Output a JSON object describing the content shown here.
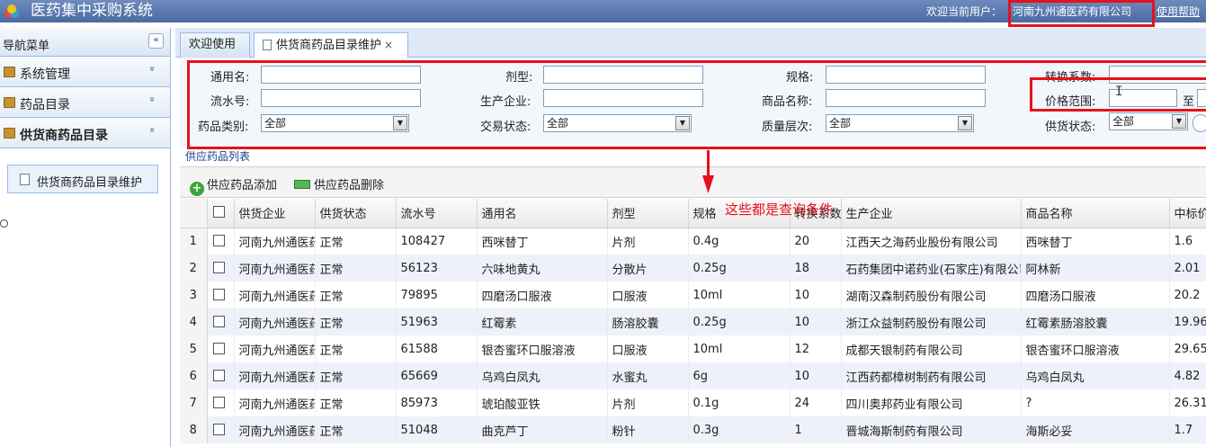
{
  "header": {
    "title": "医药集中采购系统",
    "welcome": "欢迎当前用户：",
    "user": "河南九州通医药有限公司",
    "help": "使用帮助"
  },
  "sidebar": {
    "title": "导航菜单",
    "collapse": "«",
    "groups": [
      {
        "label": "系统管理",
        "chevron": "»"
      },
      {
        "label": "药品目录",
        "chevron": "»"
      },
      {
        "label": "供货商药品目录",
        "chevron": "«"
      }
    ],
    "sub_item": "供货商药品目录维护"
  },
  "tabs": [
    {
      "label": "欢迎使用"
    },
    {
      "label": "供货商药品目录维护",
      "close": "×"
    }
  ],
  "search": {
    "generic_name": "通用名:",
    "dosage_form": "剂型:",
    "spec": "规格:",
    "conversion": "转换系数:",
    "serial_no": "流水号:",
    "manufacturer": "生产企业:",
    "product_name": "商品名称:",
    "price_range": "价格范围:",
    "price_to": "至",
    "category": "药品类别:",
    "trade_status": "交易状态:",
    "quality_level": "质量层次:",
    "supply_status": "供货状态:",
    "category_value": "全部",
    "trade_status_value": "全部",
    "quality_level_value": "全部",
    "supply_status_value": "全部",
    "dropdown_arrow": "▼"
  },
  "list": {
    "title": "供应药品列表",
    "add_button": "供应药品添加",
    "delete_button": "供应药品删除",
    "annotation": "这些都是查询条件"
  },
  "grid": {
    "columns": [
      "供货企业",
      "供货状态",
      "流水号",
      "通用名",
      "剂型",
      "规格",
      "转换系数",
      "生产企业",
      "商品名称",
      "中标价"
    ],
    "rows": [
      {
        "n": "1",
        "supplier": "河南九州通医药有限公司",
        "status": "正常",
        "serial": "108427",
        "name": "西咪替丁",
        "form": "片剂",
        "spec": "0.4g",
        "factor": "20",
        "maker": "江西天之海药业股份有限公司",
        "product": "西咪替丁",
        "price": "1.6"
      },
      {
        "n": "2",
        "supplier": "河南九州通医药有限公司",
        "status": "正常",
        "serial": "56123",
        "name": "六味地黄丸",
        "form": "分散片",
        "spec": "0.25g",
        "factor": "18",
        "maker": "石药集团中诺药业(石家庄)有限公司",
        "product": "阿林新",
        "price": "2.01"
      },
      {
        "n": "3",
        "supplier": "河南九州通医药有限公司",
        "status": "正常",
        "serial": "79895",
        "name": "四磨汤口服液",
        "form": "口服液",
        "spec": "10ml",
        "factor": "10",
        "maker": "湖南汉森制药股份有限公司",
        "product": "四磨汤口服液",
        "price": "20.2"
      },
      {
        "n": "4",
        "supplier": "河南九州通医药有限公司",
        "status": "正常",
        "serial": "51963",
        "name": "红霉素",
        "form": "肠溶胶囊",
        "spec": "0.25g",
        "factor": "10",
        "maker": "浙江众益制药股份有限公司",
        "product": "红霉素肠溶胶囊",
        "price": "19.96"
      },
      {
        "n": "5",
        "supplier": "河南九州通医药有限公司",
        "status": "正常",
        "serial": "61588",
        "name": "银杏蜜环口服溶液",
        "form": "口服液",
        "spec": "10ml",
        "factor": "12",
        "maker": "成都天银制药有限公司",
        "product": "银杏蜜环口服溶液",
        "price": "29.65"
      },
      {
        "n": "6",
        "supplier": "河南九州通医药有限公司",
        "status": "正常",
        "serial": "65669",
        "name": "乌鸡白凤丸",
        "form": "水蜜丸",
        "spec": "6g",
        "factor": "10",
        "maker": "江西药都樟树制药有限公司",
        "product": "乌鸡白凤丸",
        "price": "4.82"
      },
      {
        "n": "7",
        "supplier": "河南九州通医药有限公司",
        "status": "正常",
        "serial": "85973",
        "name": "琥珀酸亚铁",
        "form": "片剂",
        "spec": "0.1g",
        "factor": "24",
        "maker": "四川奥邦药业有限公司",
        "product": "?",
        "price": "26.31"
      },
      {
        "n": "8",
        "supplier": "河南九州通医药有限公司",
        "status": "正常",
        "serial": "51048",
        "name": "曲克芦丁",
        "form": "粉针",
        "spec": "0.3g",
        "factor": "1",
        "maker": "晋城海斯制药有限公司",
        "product": "海斯必妥",
        "price": "1.7"
      }
    ]
  },
  "colors": {
    "header_bg": "#4a6aa2",
    "highlight_red": "#e8101a",
    "row_alt": "#eef1f9"
  },
  "icons": [
    "logo-icon",
    "folder-icon",
    "doc-icon",
    "add-icon",
    "delete-icon",
    "collapse-icon",
    "chevron-icon",
    "dropdown-icon"
  ]
}
